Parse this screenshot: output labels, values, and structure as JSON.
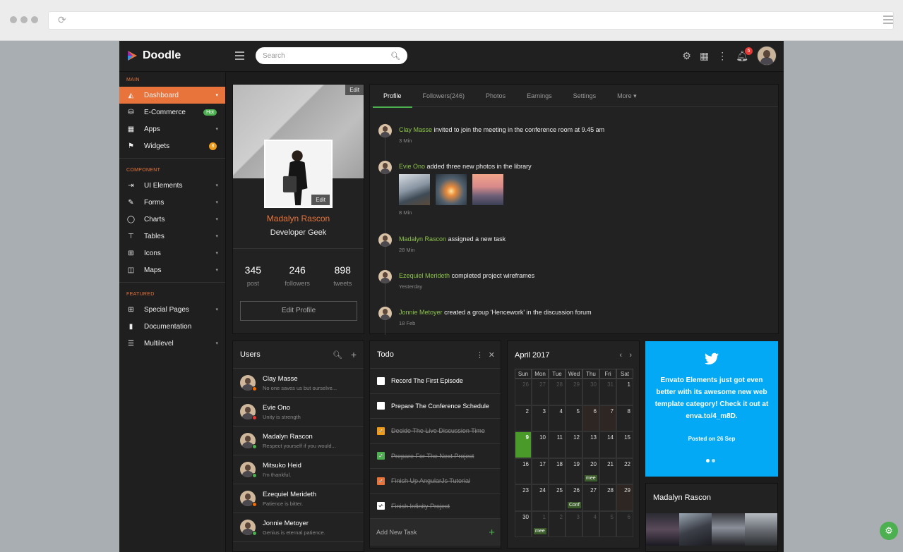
{
  "app": {
    "name": "Doodle"
  },
  "search": {
    "placeholder": "Search"
  },
  "topbar": {
    "notif_count": "5"
  },
  "sidebar": {
    "sections": [
      {
        "title": "MAIN",
        "items": [
          {
            "label": "Dashboard",
            "icon": "dashboard-icon"
          },
          {
            "label": "E-Commerce",
            "icon": "basket-icon",
            "badge": "Hot"
          },
          {
            "label": "Apps",
            "icon": "grid-icon"
          },
          {
            "label": "Widgets",
            "icon": "flag-icon",
            "badge": "8"
          }
        ]
      },
      {
        "title": "COMPONENT",
        "items": [
          {
            "label": "UI Elements",
            "icon": "ui-elements-icon"
          },
          {
            "label": "Forms",
            "icon": "pencil-icon"
          },
          {
            "label": "Charts",
            "icon": "circle-icon"
          },
          {
            "label": "Tables",
            "icon": "table-icon"
          },
          {
            "label": "Icons",
            "icon": "icons-icon"
          },
          {
            "label": "Maps",
            "icon": "map-icon"
          }
        ]
      },
      {
        "title": "FEATURED",
        "items": [
          {
            "label": "Special Pages",
            "icon": "plus-box-icon"
          },
          {
            "label": "Documentation",
            "icon": "book-icon"
          },
          {
            "label": "Multilevel",
            "icon": "filter-icon"
          }
        ]
      }
    ]
  },
  "profile": {
    "edit": "Edit",
    "name": "Madalyn Rascon",
    "role": "Developer Geek",
    "stats": [
      {
        "value": "345",
        "label": "post"
      },
      {
        "value": "246",
        "label": "followers"
      },
      {
        "value": "898",
        "label": "tweets"
      }
    ],
    "edit_profile": "Edit Profile"
  },
  "feed": {
    "tabs": [
      "Profile",
      "Followers(246)",
      "Photos",
      "Earnings",
      "Settings",
      "More ▾"
    ],
    "items": [
      {
        "name": "Clay Masse",
        "text": "invited to join the meeting in the conference room at 9.45 am",
        "time": "3 Min"
      },
      {
        "name": "Evie Ono",
        "text": "added three new photos in the library",
        "time": "8 Min"
      },
      {
        "name": "Madalyn Rascon",
        "text": "assigned a new task",
        "time": "28 Min"
      },
      {
        "name": "Ezequiel Merideth",
        "text": "completed project wireframes",
        "time": "Yesterday"
      },
      {
        "name": "Jonnie Metoyer",
        "text": "created a group 'Hencework' in the discussion forum",
        "time": "18 Feb"
      }
    ]
  },
  "users": {
    "title": "Users",
    "list": [
      {
        "name": "Clay Masse",
        "status": "No one saves us but ourselve...",
        "dot": "#ef6c00"
      },
      {
        "name": "Evie Ono",
        "status": "Unity is strength",
        "dot": "#e53935"
      },
      {
        "name": "Madalyn Rascon",
        "status": "Respect yourself if you would...",
        "dot": "#4caf50"
      },
      {
        "name": "Mitsuko Heid",
        "status": "I'm thankful.",
        "dot": "#4caf50"
      },
      {
        "name": "Ezequiel Merideth",
        "status": "Patience is bitter.",
        "dot": "#ef6c00"
      },
      {
        "name": "Jonnie Metoyer",
        "status": "Genius is eternal patience.",
        "dot": "#4caf50"
      }
    ]
  },
  "todo": {
    "title": "Todo",
    "tasks": [
      {
        "label": "Record The First Episode",
        "done": false,
        "color": "#ffffff"
      },
      {
        "label": "Prepare The Conference Schedule",
        "done": false,
        "color": "#ffffff"
      },
      {
        "label": "Decide The Live Discussion Time",
        "done": true,
        "color": "#ef9b1b"
      },
      {
        "label": "Prepare For The Next Project",
        "done": true,
        "color": "#4caf50"
      },
      {
        "label": "Finish Up AngularJs Tutorial",
        "done": true,
        "color": "#e8743b"
      },
      {
        "label": "Finish Infinity Project",
        "done": true,
        "color": "#ffffff"
      }
    ],
    "add_label": "Add New Task"
  },
  "calendar": {
    "title": "April 2017",
    "days": [
      "Sun",
      "Mon",
      "Tue",
      "Wed",
      "Thu",
      "Fri",
      "Sat"
    ],
    "weeks": [
      [
        "26",
        "27",
        "28",
        "29",
        "30",
        "31",
        "1"
      ],
      [
        "2",
        "3",
        "4",
        "5",
        "6",
        "7",
        "8"
      ],
      [
        "9",
        "10",
        "11",
        "12",
        "13",
        "14",
        "15"
      ],
      [
        "16",
        "17",
        "18",
        "19",
        "20",
        "21",
        "22"
      ],
      [
        "23",
        "24",
        "25",
        "26",
        "27",
        "28",
        "29"
      ],
      [
        "30",
        "1",
        "2",
        "3",
        "4",
        "5",
        "6"
      ]
    ],
    "events": [
      {
        "week": 3,
        "day": 4,
        "label": "mee"
      },
      {
        "week": 4,
        "day": 3,
        "label": "Conf"
      },
      {
        "week": 5,
        "day": 1,
        "label": "mee"
      }
    ]
  },
  "tweet": {
    "text": "Envato Elements just got even better with its awesome new web template category! Check it out at enva.to/4_m8D.",
    "posted": "Posted on 26 Sep"
  },
  "gallery": {
    "title": "Madalyn Rascon"
  },
  "colors": {
    "accent": "#e8743b",
    "green": "#4caf50",
    "twitter": "#03a9f4"
  }
}
